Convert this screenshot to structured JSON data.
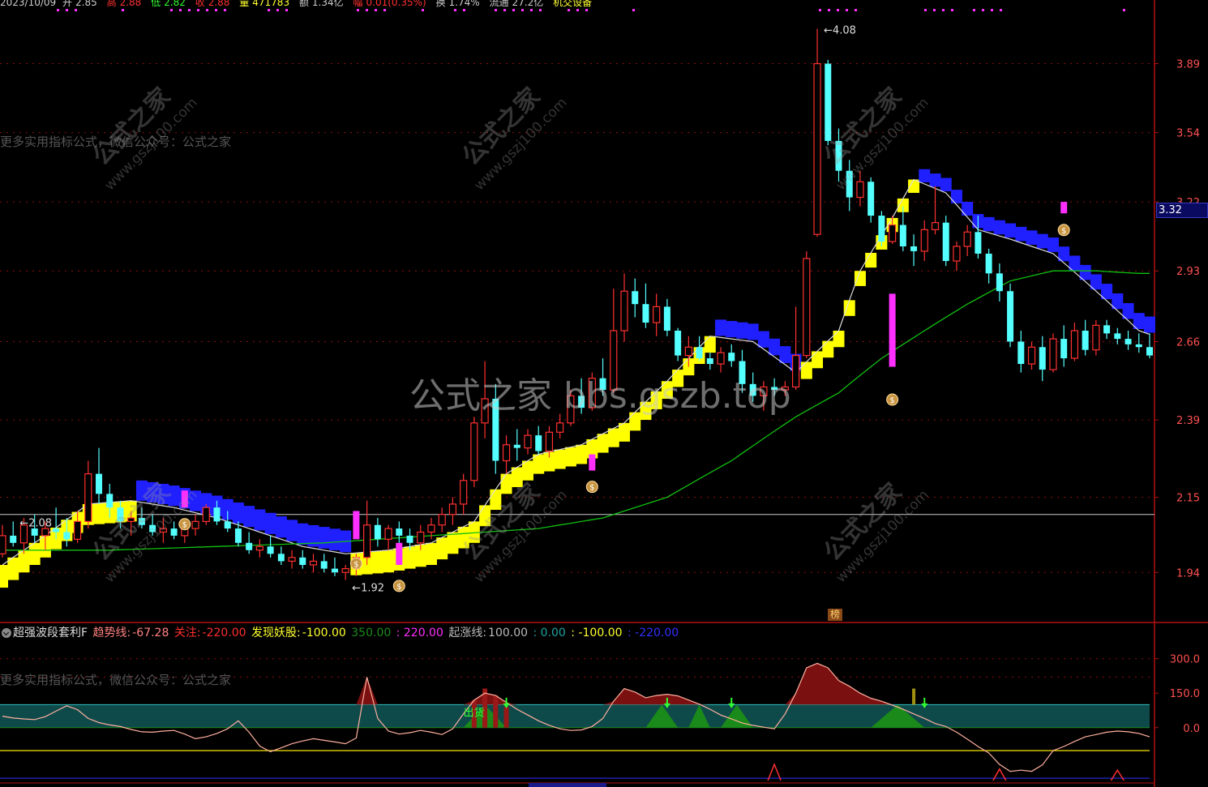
{
  "top_bar": {
    "date": "2023/10/09",
    "open_label": "开",
    "open": "2.85",
    "high_label": "高",
    "high": "2.88",
    "low_label": "低",
    "low": "2.82",
    "close_label": "收",
    "close": "2.88",
    "volume_label": "量",
    "volume": "471783",
    "amount_label": "额",
    "amount": "1.34亿",
    "change_label": "幅",
    "change": "0.01(0.35%)",
    "turnover_label": "换",
    "turnover": "1.74%",
    "float_label": "流通",
    "float": "27.2亿",
    "trade_button": "机交设备"
  },
  "promo_text": "更多实用指标公式，微信公众号：公式之家",
  "watermark_big": "公式之家 bbs.gszb.top",
  "watermark_small": "公式之家",
  "watermark_url": "www.gszj100.com",
  "badge_bang": "榜",
  "current_price_tag": "3.32",
  "indicator_header": {
    "name": "超强波段套利F",
    "trend_label": "趋势线:",
    "trend_value": "-67.28",
    "focus_label": "关注:",
    "focus_value": "-220.00",
    "demon_label": "发现妖股:",
    "demon_value": "-100.00",
    "v1": "350.00",
    "v2": ": 220.00",
    "rise_label": "起涨线:",
    "rise_value": "100.00",
    "v3": ": 0.00",
    "v4": ": -100.00",
    "v5": ": -220.00"
  },
  "annotation_sell": "出货",
  "colors": {
    "up": "#ff3030",
    "down": "#54ffff",
    "yellow": "#ffff00",
    "blue": "#2020ff",
    "ma_green": "#10c010",
    "grid": "#8a1010",
    "magenta": "#ff30ff"
  },
  "chart_data": [
    {
      "type": "candlestick",
      "title": "",
      "ylim": [
        1.84,
        4.16
      ],
      "y_ticks": [
        3.89,
        3.54,
        3.22,
        2.93,
        2.66,
        2.39,
        2.15,
        1.94
      ],
      "annotations": [
        {
          "text": "4.08",
          "value": 4.08
        },
        {
          "text": "2.08",
          "value": 2.08
        },
        {
          "text": "1.92",
          "value": 1.92
        }
      ],
      "ohlc": [
        [
          1.99,
          2.07,
          1.98,
          2.04
        ],
        [
          2.04,
          2.08,
          2.01,
          2.02
        ],
        [
          2.02,
          2.09,
          1.99,
          2.07
        ],
        [
          2.06,
          2.1,
          2.02,
          2.04
        ],
        [
          2.04,
          2.08,
          2.0,
          2.06
        ],
        [
          2.06,
          2.12,
          2.03,
          2.05
        ],
        [
          2.05,
          2.09,
          2.01,
          2.03
        ],
        [
          2.03,
          2.11,
          2.02,
          2.08
        ],
        [
          2.08,
          2.26,
          2.06,
          2.22
        ],
        [
          2.22,
          2.3,
          2.13,
          2.16
        ],
        [
          2.16,
          2.19,
          2.09,
          2.12
        ],
        [
          2.12,
          2.14,
          2.06,
          2.08
        ],
        [
          2.08,
          2.11,
          2.04,
          2.09
        ],
        [
          2.09,
          2.12,
          2.06,
          2.07
        ],
        [
          2.07,
          2.1,
          2.04,
          2.05
        ],
        [
          2.05,
          2.09,
          2.02,
          2.06
        ],
        [
          2.06,
          2.08,
          2.03,
          2.04
        ],
        [
          2.04,
          2.07,
          2.02,
          2.06
        ],
        [
          2.06,
          2.1,
          2.04,
          2.08
        ],
        [
          2.08,
          2.13,
          2.07,
          2.12
        ],
        [
          2.12,
          2.14,
          2.07,
          2.08
        ],
        [
          2.08,
          2.11,
          2.05,
          2.06
        ],
        [
          2.06,
          2.08,
          2.01,
          2.02
        ],
        [
          2.02,
          2.05,
          1.99,
          2.0
        ],
        [
          2.0,
          2.03,
          1.98,
          2.01
        ],
        [
          2.01,
          2.04,
          1.98,
          1.99
        ],
        [
          1.99,
          2.01,
          1.96,
          1.97
        ],
        [
          1.97,
          2.0,
          1.95,
          1.98
        ],
        [
          1.98,
          2.0,
          1.95,
          1.96
        ],
        [
          1.96,
          1.99,
          1.94,
          1.97
        ],
        [
          1.97,
          1.99,
          1.94,
          1.95
        ],
        [
          1.95,
          1.98,
          1.93,
          1.94
        ],
        [
          1.94,
          1.96,
          1.92,
          1.95
        ],
        [
          1.95,
          1.99,
          1.93,
          1.98
        ],
        [
          1.98,
          2.14,
          1.96,
          2.07
        ],
        [
          2.07,
          2.09,
          2.01,
          2.03
        ],
        [
          2.03,
          2.07,
          2.0,
          2.06
        ],
        [
          2.06,
          2.08,
          2.02,
          2.04
        ],
        [
          2.04,
          2.06,
          2.0,
          2.02
        ],
        [
          2.02,
          2.07,
          2.0,
          2.05
        ],
        [
          2.05,
          2.09,
          2.03,
          2.07
        ],
        [
          2.07,
          2.12,
          2.05,
          2.1
        ],
        [
          2.1,
          2.15,
          2.07,
          2.13
        ],
        [
          2.13,
          2.22,
          2.1,
          2.2
        ],
        [
          2.2,
          2.4,
          2.18,
          2.38
        ],
        [
          2.38,
          2.59,
          2.33,
          2.46
        ],
        [
          2.46,
          2.51,
          2.22,
          2.26
        ],
        [
          2.26,
          2.34,
          2.22,
          2.31
        ],
        [
          2.31,
          2.36,
          2.26,
          2.3
        ],
        [
          2.3,
          2.36,
          2.28,
          2.34
        ],
        [
          2.34,
          2.37,
          2.28,
          2.29
        ],
        [
          2.29,
          2.37,
          2.27,
          2.35
        ],
        [
          2.35,
          2.41,
          2.33,
          2.38
        ],
        [
          2.38,
          2.49,
          2.37,
          2.47
        ],
        [
          2.47,
          2.53,
          2.41,
          2.43
        ],
        [
          2.43,
          2.55,
          2.42,
          2.53
        ],
        [
          2.53,
          2.6,
          2.47,
          2.49
        ],
        [
          2.49,
          2.86,
          2.48,
          2.7
        ],
        [
          2.7,
          2.92,
          2.66,
          2.85
        ],
        [
          2.85,
          2.9,
          2.75,
          2.8
        ],
        [
          2.8,
          2.88,
          2.71,
          2.73
        ],
        [
          2.73,
          2.84,
          2.68,
          2.79
        ],
        [
          2.79,
          2.82,
          2.68,
          2.7
        ],
        [
          2.7,
          2.71,
          2.59,
          2.61
        ],
        [
          2.61,
          2.68,
          2.57,
          2.64
        ],
        [
          2.64,
          2.68,
          2.59,
          2.6
        ],
        [
          2.6,
          2.62,
          2.56,
          2.58
        ],
        [
          2.58,
          2.64,
          2.55,
          2.62
        ],
        [
          2.62,
          2.65,
          2.57,
          2.59
        ],
        [
          2.59,
          2.63,
          2.48,
          2.51
        ],
        [
          2.51,
          2.55,
          2.45,
          2.47
        ],
        [
          2.47,
          2.52,
          2.42,
          2.5
        ],
        [
          2.5,
          2.53,
          2.47,
          2.49
        ],
        [
          2.49,
          2.52,
          2.47,
          2.5
        ],
        [
          2.5,
          2.79,
          2.49,
          2.61
        ],
        [
          2.61,
          3.01,
          2.6,
          2.98
        ],
        [
          3.08,
          4.08,
          3.07,
          3.89
        ],
        [
          3.89,
          3.91,
          3.48,
          3.5
        ],
        [
          3.5,
          3.56,
          3.31,
          3.36
        ],
        [
          3.36,
          3.41,
          3.18,
          3.24
        ],
        [
          3.24,
          3.36,
          3.2,
          3.31
        ],
        [
          3.31,
          3.33,
          3.13,
          3.16
        ],
        [
          3.16,
          3.18,
          3.03,
          3.05
        ],
        [
          3.05,
          3.16,
          3.04,
          3.12
        ],
        [
          3.12,
          3.2,
          3.01,
          3.03
        ],
        [
          3.03,
          3.08,
          2.95,
          3.01
        ],
        [
          3.01,
          3.14,
          2.97,
          3.1
        ],
        [
          3.1,
          3.29,
          3.08,
          3.13
        ],
        [
          3.13,
          3.16,
          2.95,
          2.97
        ],
        [
          2.97,
          3.05,
          2.93,
          3.03
        ],
        [
          3.03,
          3.12,
          2.99,
          3.09
        ],
        [
          3.09,
          3.16,
          2.98,
          3.0
        ],
        [
          3.0,
          3.02,
          2.88,
          2.92
        ],
        [
          2.92,
          2.96,
          2.81,
          2.85
        ],
        [
          2.85,
          2.88,
          2.64,
          2.66
        ],
        [
          2.66,
          2.7,
          2.55,
          2.58
        ],
        [
          2.58,
          2.66,
          2.56,
          2.64
        ],
        [
          2.64,
          2.68,
          2.52,
          2.56
        ],
        [
          2.56,
          2.69,
          2.55,
          2.67
        ],
        [
          2.67,
          2.72,
          2.57,
          2.6
        ],
        [
          2.6,
          2.73,
          2.59,
          2.7
        ],
        [
          2.7,
          2.74,
          2.61,
          2.63
        ],
        [
          2.63,
          2.74,
          2.61,
          2.72
        ],
        [
          2.72,
          2.74,
          2.67,
          2.69
        ],
        [
          2.69,
          2.71,
          2.65,
          2.67
        ],
        [
          2.67,
          2.7,
          2.63,
          2.65
        ],
        [
          2.65,
          2.69,
          2.62,
          2.64
        ],
        [
          2.64,
          2.69,
          2.6,
          2.61
        ]
      ],
      "ma_line": [
        [
          0,
          2.0
        ],
        [
          10,
          2.0
        ],
        [
          20,
          2.01
        ],
        [
          30,
          2.02
        ],
        [
          40,
          2.04
        ],
        [
          50,
          2.06
        ],
        [
          56,
          2.09
        ],
        [
          62,
          2.15
        ],
        [
          68,
          2.26
        ],
        [
          74,
          2.4
        ],
        [
          78,
          2.48
        ],
        [
          82,
          2.6
        ],
        [
          86,
          2.7
        ],
        [
          90,
          2.8
        ],
        [
          94,
          2.89
        ],
        [
          98,
          2.93
        ],
        [
          102,
          2.93
        ],
        [
          106,
          2.92
        ],
        [
          109,
          2.92
        ]
      ],
      "trend_band": [
        [
          0,
          1.96
        ],
        [
          4,
          2.04
        ],
        [
          8,
          2.13
        ],
        [
          12,
          2.14
        ],
        [
          16,
          2.12
        ],
        [
          20,
          2.09
        ],
        [
          24,
          2.05
        ],
        [
          28,
          2.01
        ],
        [
          32,
          1.99
        ],
        [
          36,
          2.0
        ],
        [
          40,
          2.02
        ],
        [
          44,
          2.08
        ],
        [
          47,
          2.22
        ],
        [
          50,
          2.28
        ],
        [
          54,
          2.31
        ],
        [
          58,
          2.38
        ],
        [
          62,
          2.52
        ],
        [
          66,
          2.68
        ],
        [
          70,
          2.66
        ],
        [
          74,
          2.55
        ],
        [
          78,
          2.7
        ],
        [
          80,
          2.93
        ],
        [
          83,
          3.15
        ],
        [
          85,
          3.32
        ],
        [
          88,
          3.26
        ],
        [
          91,
          3.1
        ],
        [
          94,
          3.06
        ],
        [
          98,
          3.0
        ],
        [
          102,
          2.85
        ],
        [
          106,
          2.7
        ],
        [
          109,
          2.66
        ]
      ],
      "reference_line": 2.1
    },
    {
      "type": "indicator",
      "title": "超强波段套利F",
      "ylim": [
        -230,
        380
      ],
      "y_ticks": [
        300.0,
        150.0,
        0.0
      ],
      "ref_lines": {
        "orange_dash": [
          300,
          220,
          -100
        ],
        "cyan_band": [
          0,
          100
        ],
        "yellow": -100,
        "blue": -220
      },
      "series": [
        {
          "name": "趋势线",
          "values": [
            50,
            42,
            38,
            35,
            48,
            72,
            95,
            78,
            40,
            22,
            12,
            5,
            -8,
            -18,
            -20,
            -15,
            -12,
            -28,
            -48,
            -40,
            -25,
            -5,
            30,
            -20,
            -80,
            -105,
            -88,
            -70,
            -58,
            -48,
            -55,
            -62,
            -70,
            -45,
            220,
            40,
            -15,
            -28,
            -22,
            -12,
            -20,
            -30,
            -5,
            60,
            120,
            150,
            140,
            110,
            80,
            55,
            30,
            10,
            -5,
            -12,
            -10,
            5,
            40,
            115,
            170,
            155,
            130,
            140,
            145,
            138,
            120,
            102,
            80,
            55,
            38,
            20,
            10,
            2,
            -5,
            60,
            150,
            260,
            280,
            260,
            205,
            180,
            150,
            128,
            115,
            98,
            80,
            60,
            40,
            18,
            5,
            -20,
            -50,
            -82,
            -110,
            -160,
            -190,
            -185,
            -190,
            -162,
            -100,
            -82,
            -60,
            -40,
            -30,
            -20,
            -15,
            -18,
            -25,
            -40
          ]
        },
        {
          "name": "发现妖股",
          "values": [
            0,
            0,
            0,
            0,
            0,
            0,
            0,
            0,
            0,
            0,
            0,
            0,
            0,
            0,
            0,
            0,
            0,
            0,
            0,
            0,
            0,
            0,
            0,
            0,
            0,
            0,
            0,
            0,
            0,
            0,
            0,
            0,
            0,
            0,
            0,
            0,
            0,
            0,
            0,
            0,
            0,
            0,
            0,
            0,
            120,
            170,
            140,
            90,
            0,
            0,
            0,
            0,
            0,
            0,
            0,
            0,
            0,
            0,
            0,
            0,
            0,
            0,
            0,
            0,
            0,
            0,
            0,
            0,
            0,
            0,
            0,
            0,
            0,
            0,
            0,
            0,
            0,
            0,
            0,
            0,
            0,
            0,
            0,
            0,
            0,
            0,
            0,
            0,
            0,
            0,
            0,
            0,
            0,
            0,
            0,
            0,
            0,
            0,
            0,
            0,
            0,
            0,
            0,
            0,
            0,
            0,
            0,
            0,
            0,
            0
          ]
        }
      ]
    }
  ]
}
